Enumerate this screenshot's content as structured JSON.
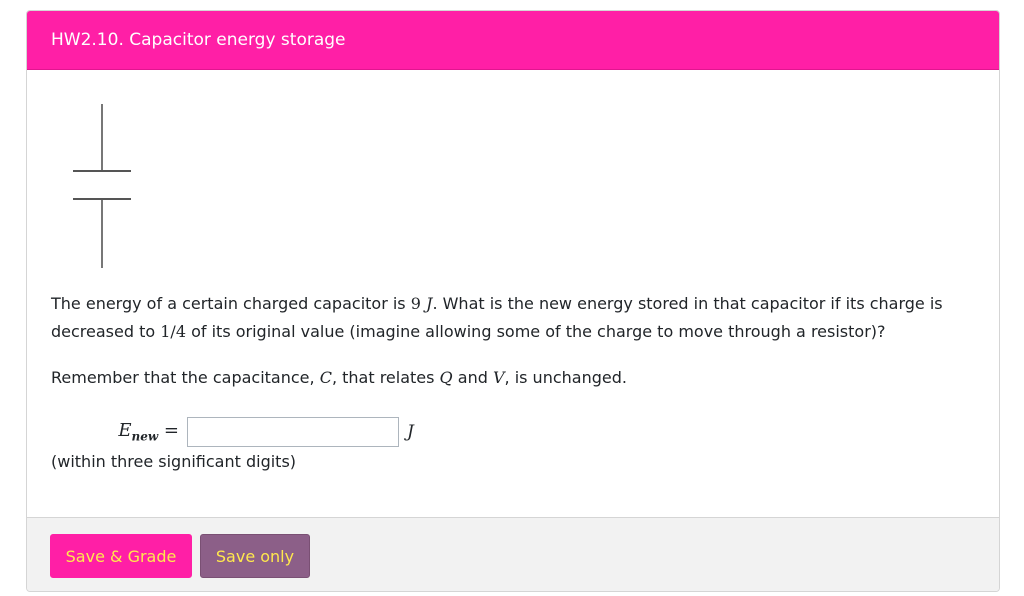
{
  "header": {
    "title": "HW2.10. Capacitor energy storage"
  },
  "icons": {
    "diagram": "capacitor-symbol-icon"
  },
  "question": {
    "p1_a": "The energy of a certain charged capacitor is ",
    "energy_value": "9",
    "energy_unit": "J",
    "p1_b": ". What is the new energy stored in that capacitor if its charge is decreased to ",
    "fraction": "1/4",
    "p1_c": " of its original value (imagine allowing some of the charge to move through a resistor)?",
    "p2_a": "Remember that the capacitance, ",
    "sym_c": "C",
    "p2_b": ", that relates ",
    "sym_q": "Q",
    "p2_c": " and ",
    "sym_v": "V",
    "p2_d": ", is unchanged."
  },
  "answer": {
    "label_main": "E",
    "label_sub": "new",
    "equals": "=",
    "value": "",
    "placeholder": "",
    "unit": "J",
    "hint": "(within three significant digits)"
  },
  "footer": {
    "grade_label": "Save & Grade",
    "save_label": "Save only"
  },
  "colors": {
    "header_bg": "#ff1fa6",
    "button_text": "#ffe84d",
    "save_only_bg": "#8c5f88"
  }
}
